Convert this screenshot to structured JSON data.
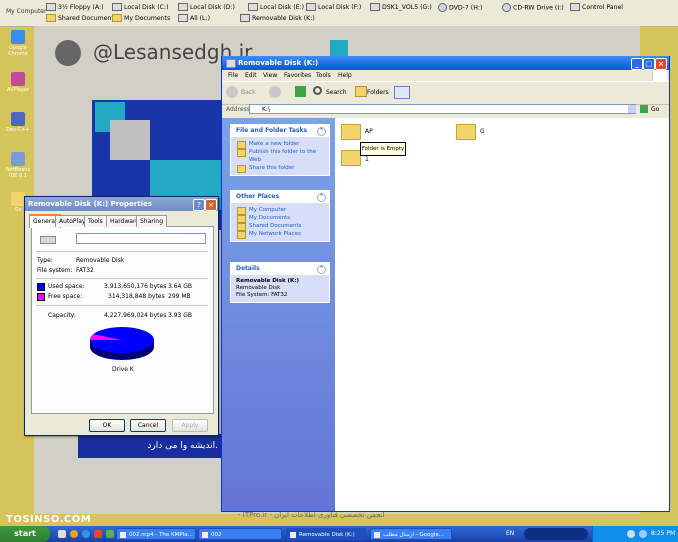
{
  "top_bar": {
    "my_computer_label": "My Computer",
    "items_row1": [
      {
        "label": "3½ Floppy (A:)",
        "icon": "floppy-icon"
      },
      {
        "label": "Local Disk (C:)",
        "icon": "drive-icon"
      },
      {
        "label": "Local Disk (D:)",
        "icon": "drive-icon"
      },
      {
        "label": "Local Disk (E:)",
        "icon": "drive-icon"
      },
      {
        "label": "Local Disk (F:)",
        "icon": "drive-icon"
      },
      {
        "label": "DSK1_VOL5 (G:)",
        "icon": "drive-icon"
      },
      {
        "label": "DVD-7 (H:)",
        "icon": "cd-icon"
      },
      {
        "label": "CD-RW Drive (I:)",
        "icon": "cd-icon"
      },
      {
        "label": "Control Panel",
        "icon": "control-panel-icon"
      }
    ],
    "items_row2": [
      {
        "label": "Shared Documents",
        "icon": "folder-icon"
      },
      {
        "label": "My Documents",
        "icon": "folder-icon"
      },
      {
        "label": "All (L:)",
        "icon": "drive-icon"
      },
      {
        "label": "Removable Disk (K:)",
        "icon": "drive-icon"
      }
    ]
  },
  "desktop": {
    "logo_text": "@Lesansedgh.ir",
    "banner_text": "اندیشه وا می دارد.",
    "footer_text": "- ITPro.ir - انجمن تخصصی فناوری اطلاعات ایران",
    "watermark": "TOSINSO.COM",
    "icons": [
      {
        "label": "Google Chrome",
        "color": "#3a8ee6"
      },
      {
        "label": "AVPlayer",
        "color": "#c04a9e"
      },
      {
        "label": "Dev-C++",
        "color": "#4a68c0"
      },
      {
        "label": "NetBeans IDE 8.1",
        "color": "#7a9bd8"
      },
      {
        "label": "Go",
        "color": "#f3d36b"
      }
    ]
  },
  "properties_dialog": {
    "title": "Removable Disk (K:) Properties",
    "tabs": [
      "General",
      "AutoPlay",
      "Tools",
      "Hardware",
      "Sharing"
    ],
    "name_value": "",
    "type_label": "Type:",
    "type_value": "Removable Disk",
    "fs_label": "File system:",
    "fs_value": "FAT32",
    "used_label": "Used space:",
    "used_bytes": "3,913,650,176 bytes",
    "used_gb": "3.64 GB",
    "free_label": "Free space:",
    "free_bytes": "314,318,848 bytes",
    "free_gb": "299 MB",
    "capacity_label": "Capacity:",
    "capacity_bytes": "4,227,969,024 bytes",
    "capacity_gb": "3.93 GB",
    "drive_label": "Drive K",
    "used_fraction": 0.926,
    "used_color": "#0000ff",
    "free_color": "#ff00ff",
    "ok_label": "OK",
    "cancel_label": "Cancel",
    "apply_label": "Apply",
    "help_glyph": "?",
    "close_glyph": "×"
  },
  "explorer": {
    "title": "Removable Disk (K:)",
    "menu": [
      "File",
      "Edit",
      "View",
      "Favorites",
      "Tools",
      "Help"
    ],
    "toolbar": {
      "back_label": "Back",
      "search_label": "Search",
      "folders_label": "Folders"
    },
    "address_label": "Address",
    "address_value": "K:\\",
    "go_label": "Go",
    "file_tasks": {
      "header": "File and Folder Tasks",
      "items": [
        "Make a new folder",
        "Publish this folder to the Web",
        "Share this folder"
      ]
    },
    "other_places": {
      "header": "Other Places",
      "items": [
        "My Computer",
        "My Documents",
        "Shared Documents",
        "My Network Places"
      ]
    },
    "details": {
      "header": "Details",
      "name": "Removable Disk (K:)",
      "type": "Removable Disk",
      "fs": "File System: FAT32"
    },
    "folders": [
      {
        "name": "AP"
      },
      {
        "name": "G"
      },
      {
        "name": "1"
      }
    ],
    "tooltip": "Folder is Empty"
  },
  "taskbar": {
    "start_label": "start",
    "tasks": [
      {
        "label": "002.mp4 - The KMPla...",
        "active": false
      },
      {
        "label": "002",
        "active": false
      },
      {
        "label": "Removable Disk (K:)",
        "active": true
      },
      {
        "label": "ارسال مطلب - Google...",
        "active": false
      }
    ],
    "language": "EN",
    "clock": "8:25 PM"
  }
}
